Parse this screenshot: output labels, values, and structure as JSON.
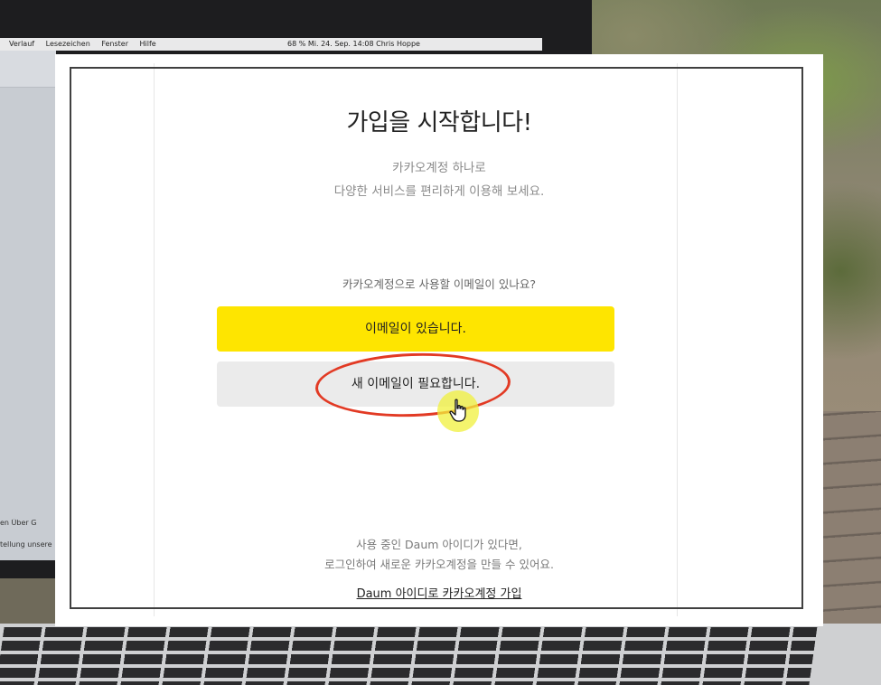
{
  "background": {
    "menubar": {
      "items": [
        "Verlauf",
        "Lesezeichen",
        "Fenster",
        "Hilfe"
      ],
      "status": "68 %   Mi. 24. Sep.  14:08   Chris Hoppe"
    },
    "side_texts": [
      "en   Über G",
      "tellung unsere"
    ]
  },
  "signup": {
    "title": "가입을 시작합니다!",
    "subtitle_line1": "카카오계정 하나로",
    "subtitle_line2": "다양한 서비스를 편리하게 이용해 보세요.",
    "question": "카카오계정으로 사용할 이메일이 있나요?",
    "btn_has_email": "이메일이 있습니다.",
    "btn_need_email": "새 이메일이 필요합니다.",
    "footer_line1": "사용 중인 Daum 아이디가 있다면,",
    "footer_line2": "로그인하여 새로운 카카오계정을 만들 수 있어요.",
    "daum_link": "Daum 아이디로 카카오계정 가입"
  },
  "colors": {
    "primary_button": "#fee500",
    "secondary_button": "#ebebeb",
    "annotation": "#e23a24"
  },
  "icons": {
    "cursor": "hand-pointer-icon"
  }
}
